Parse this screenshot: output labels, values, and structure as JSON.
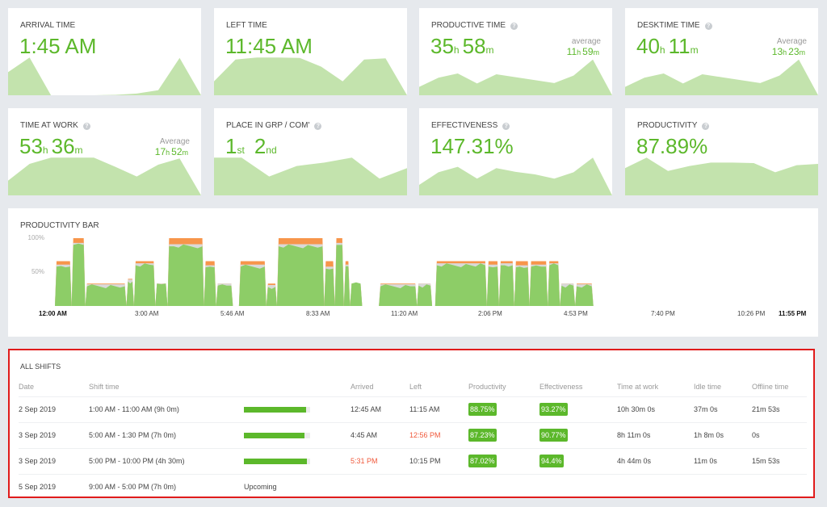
{
  "colors": {
    "accent_green": "#5cb82b",
    "spark_fill": "#c3e3ad",
    "bar_green": "#8dcd67",
    "bar_orange": "#f7954b",
    "bar_grey": "#d9d9d9",
    "late_red": "#f0583a",
    "highlight_border": "#e01b1b"
  },
  "cards": [
    {
      "title": "ARRIVAL TIME",
      "has_help": false,
      "value": "1:45 AM",
      "spark": [
        0.55,
        0.9,
        0.0,
        0.0,
        0.0,
        0.01,
        0.04,
        0.12,
        0.89,
        0.0
      ]
    },
    {
      "title": "LEFT TIME",
      "has_help": false,
      "value": "11:45 AM",
      "spark": [
        0.33,
        0.85,
        0.9,
        0.9,
        0.89,
        0.68,
        0.33,
        0.85,
        0.88,
        0.0
      ]
    },
    {
      "title": "PRODUCTIVE TIME",
      "has_help": true,
      "value_parts": [
        {
          "num": "35",
          "unit": "h"
        },
        {
          "num": "58",
          "unit": "m"
        }
      ],
      "avg_label": "average",
      "avg_parts": [
        {
          "num": "11",
          "unit": "h"
        },
        {
          "num": "59",
          "unit": "m"
        }
      ],
      "spark": [
        0.2,
        0.42,
        0.52,
        0.28,
        0.5,
        0.43,
        0.36,
        0.29,
        0.47,
        0.85,
        0.0
      ]
    },
    {
      "title": "DESKTIME TIME",
      "has_help": true,
      "value_parts": [
        {
          "num": "40",
          "unit": "h"
        },
        {
          "num": "11",
          "unit": "m"
        }
      ],
      "avg_label": "Average",
      "avg_parts": [
        {
          "num": "13",
          "unit": "h"
        },
        {
          "num": "23",
          "unit": "m"
        }
      ],
      "spark": [
        0.2,
        0.42,
        0.52,
        0.28,
        0.5,
        0.43,
        0.36,
        0.29,
        0.47,
        0.85,
        0.0
      ]
    },
    {
      "title": "TIME AT WORK",
      "has_help": true,
      "value_parts": [
        {
          "num": "53",
          "unit": "h"
        },
        {
          "num": "36",
          "unit": "m"
        }
      ],
      "avg_label": "Average",
      "avg_parts": [
        {
          "num": "17",
          "unit": "h"
        },
        {
          "num": "52",
          "unit": "m"
        }
      ],
      "spark": [
        0.35,
        0.75,
        0.9,
        0.9,
        0.9,
        0.68,
        0.45,
        0.73,
        0.88,
        0.0
      ]
    },
    {
      "title": "PLACE IN GRP / COM'",
      "has_help": true,
      "value_parts": [
        {
          "num": "1",
          "unit": "st"
        },
        {
          "num": "2",
          "unit": "nd"
        }
      ],
      "spark": [
        0.9,
        0.9,
        0.45,
        0.7,
        0.78,
        0.9,
        0.4,
        0.65
      ]
    },
    {
      "title": "EFFECTIVENESS",
      "has_help": true,
      "value": "147.31%",
      "spark": [
        0.25,
        0.55,
        0.68,
        0.4,
        0.65,
        0.56,
        0.5,
        0.4,
        0.55,
        0.9,
        0.0
      ]
    },
    {
      "title": "PRODUCTIVITY",
      "has_help": true,
      "value": "87.89%",
      "spark": [
        0.65,
        0.9,
        0.58,
        0.7,
        0.78,
        0.78,
        0.77,
        0.55,
        0.72,
        0.75
      ]
    }
  ],
  "productivity_bar": {
    "title": "PRODUCTIVITY BAR",
    "y_labels": [
      "100%",
      "50%"
    ],
    "x_labels": [
      {
        "label": "12:00 AM",
        "bold": true
      },
      {
        "label": "3:00 AM",
        "bold": false
      },
      {
        "label": "5:46 AM",
        "bold": false
      },
      {
        "label": "8:33 AM",
        "bold": false
      },
      {
        "label": "11:20 AM",
        "bold": false
      },
      {
        "label": "2:06 PM",
        "bold": false
      },
      {
        "label": "4:53 PM",
        "bold": false
      },
      {
        "label": "7:40 PM",
        "bold": false
      },
      {
        "label": "10:26 PM",
        "bold": false
      },
      {
        "label": "11:55 PM",
        "bold": true
      }
    ]
  },
  "chart_data": {
    "type": "area",
    "title": "PRODUCTIVITY BAR",
    "ylim": [
      0,
      100
    ],
    "y_ticks": [
      "50%",
      "100%"
    ],
    "x_ticks": [
      "12:00 AM",
      "3:00 AM",
      "5:46 AM",
      "8:33 AM",
      "11:20 AM",
      "2:06 PM",
      "4:53 PM",
      "7:40 PM",
      "10:26 PM",
      "11:55 PM"
    ],
    "x_range_hours": [
      0,
      24
    ],
    "series_names": [
      "productive",
      "neutral",
      "unproductive"
    ],
    "segments": [
      {
        "start": 0.0,
        "end": 0.55,
        "total": 66,
        "productive": 58
      },
      {
        "start": 0.55,
        "end": 1.0,
        "total": 100,
        "productive": 90
      },
      {
        "start": 1.0,
        "end": 2.35,
        "total": 33,
        "productive": 29
      },
      {
        "start": 2.35,
        "end": 2.6,
        "total": 40,
        "productive": 36
      },
      {
        "start": 2.6,
        "end": 3.3,
        "total": 66,
        "productive": 60
      },
      {
        "start": 3.3,
        "end": 3.7,
        "total": 33,
        "productive": 33
      },
      {
        "start": 3.7,
        "end": 4.9,
        "total": 100,
        "productive": 88
      },
      {
        "start": 4.9,
        "end": 5.3,
        "total": 66,
        "productive": 57
      },
      {
        "start": 5.3,
        "end": 5.85,
        "total": 33,
        "productive": 30
      },
      {
        "start": 6.05,
        "end": 6.95,
        "total": 66,
        "productive": 58
      },
      {
        "start": 6.95,
        "end": 7.3,
        "total": 33,
        "productive": 28
      },
      {
        "start": 7.3,
        "end": 8.85,
        "total": 100,
        "productive": 88
      },
      {
        "start": 8.85,
        "end": 9.2,
        "total": 66,
        "productive": 55
      },
      {
        "start": 9.2,
        "end": 9.5,
        "total": 100,
        "productive": 90
      },
      {
        "start": 9.5,
        "end": 9.7,
        "total": 66,
        "productive": 58
      },
      {
        "start": 9.7,
        "end": 10.1,
        "total": 33,
        "productive": 33
      },
      {
        "start": 10.65,
        "end": 11.9,
        "total": 33,
        "productive": 29
      },
      {
        "start": 11.9,
        "end": 12.4,
        "total": 33,
        "productive": 30
      },
      {
        "start": 12.5,
        "end": 14.2,
        "total": 66,
        "productive": 60
      },
      {
        "start": 14.2,
        "end": 14.6,
        "total": 66,
        "productive": 58
      },
      {
        "start": 14.6,
        "end": 15.1,
        "total": 66,
        "productive": 60
      },
      {
        "start": 15.1,
        "end": 15.6,
        "total": 66,
        "productive": 57
      },
      {
        "start": 15.6,
        "end": 16.2,
        "total": 66,
        "productive": 58
      },
      {
        "start": 16.2,
        "end": 16.6,
        "total": 66,
        "productive": 60
      },
      {
        "start": 16.6,
        "end": 17.1,
        "total": 33,
        "productive": 30
      },
      {
        "start": 17.1,
        "end": 17.7,
        "total": 33,
        "productive": 29
      }
    ]
  },
  "shifts": {
    "title": "ALL SHIFTS",
    "columns": [
      "Date",
      "Shift time",
      "",
      "Arrived",
      "Left",
      "Productivity",
      "Effectiveness",
      "Time at work",
      "Idle time",
      "Offline time"
    ],
    "rows": [
      {
        "date": "2 Sep 2019",
        "shift_time": "1:00 AM - 11:00 AM (9h 0m)",
        "progress": 0.94,
        "status": "",
        "arrived": "12:45 AM",
        "arrived_late": false,
        "left": "11:15 AM",
        "left_early": false,
        "productivity": "88.75%",
        "effectiveness": "93.27%",
        "time_at_work": "10h 30m 0s",
        "idle_time": "37m 0s",
        "offline_time": "21m 53s"
      },
      {
        "date": "3 Sep 2019",
        "shift_time": "5:00 AM - 1:30 PM (7h 0m)",
        "progress": 0.91,
        "status": "",
        "arrived": "4:45 AM",
        "arrived_late": false,
        "left": "12:56 PM",
        "left_early": true,
        "productivity": "87.23%",
        "effectiveness": "90.77%",
        "time_at_work": "8h 11m 0s",
        "idle_time": "1h 8m 0s",
        "offline_time": "0s"
      },
      {
        "date": "3 Sep 2019",
        "shift_time": "5:00 PM - 10:00 PM (4h 30m)",
        "progress": 0.95,
        "status": "",
        "arrived": "5:31 PM",
        "arrived_late": true,
        "left": "10:15 PM",
        "left_early": false,
        "productivity": "87.02%",
        "effectiveness": "94.4%",
        "time_at_work": "4h 44m 0s",
        "idle_time": "11m 0s",
        "offline_time": "15m 53s"
      },
      {
        "date": "5 Sep 2019",
        "shift_time": "9:00 AM - 5:00 PM (7h 0m)",
        "progress": null,
        "status": "Upcoming",
        "arrived": "",
        "arrived_late": false,
        "left": "",
        "left_early": false,
        "productivity": "",
        "effectiveness": "",
        "time_at_work": "",
        "idle_time": "",
        "offline_time": ""
      }
    ]
  }
}
